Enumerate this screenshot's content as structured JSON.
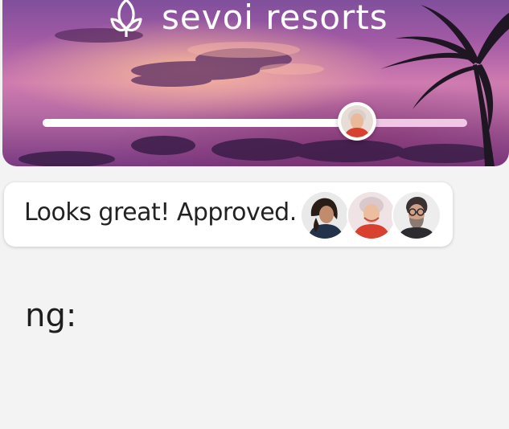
{
  "brand": {
    "name": "sevoi resorts",
    "icon": "lotus-icon"
  },
  "progress": {
    "value": 0.74
  },
  "comment": {
    "text": "Looks great! Approved.",
    "reviewers": [
      "reviewer-1",
      "reviewer-2",
      "reviewer-3"
    ]
  },
  "heading_fragment": "ng:",
  "colors": {
    "background": "#f3f3f3",
    "sky_top": "#6f4a98",
    "sky_mid": "#cf7bb0",
    "progress_track": "#f0c8e6",
    "progress_fill": "#ffffff",
    "text": "#222222"
  }
}
